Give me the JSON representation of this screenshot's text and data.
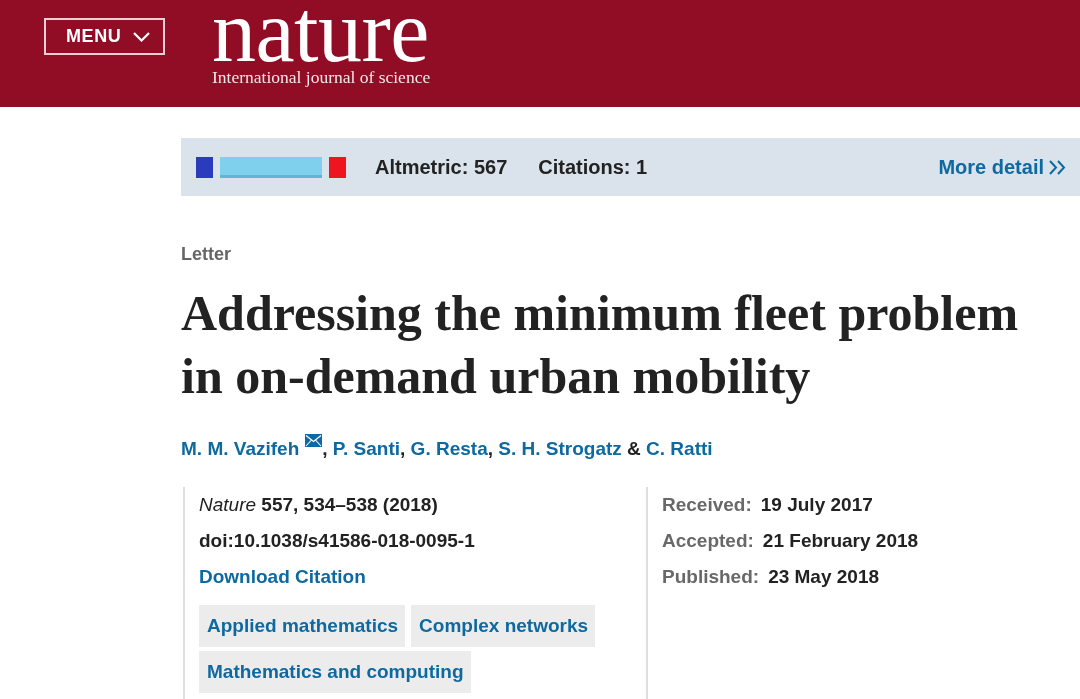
{
  "header": {
    "menu_button": "MENU",
    "logo": "nature",
    "tagline": "International journal of science"
  },
  "metrics_bar": {
    "altmetric": "Altmetric: 567",
    "citations": "Citations: 1",
    "more_link": "More detail"
  },
  "article": {
    "type": "Letter",
    "title": "Addressing the minimum fleet problem in on-demand urban mobility",
    "authors": [
      {
        "name": "M. M. Vazifeh",
        "corresponding": true,
        "separator": ", "
      },
      {
        "name": "P. Santi",
        "corresponding": false,
        "separator": ", "
      },
      {
        "name": "G. Resta",
        "corresponding": false,
        "separator": ", "
      },
      {
        "name": "S. H. Strogatz",
        "corresponding": false,
        "separator": " & "
      },
      {
        "name": "C. Ratti",
        "corresponding": false
      }
    ],
    "citation": "*Nature* **557, 534–538 (2018)**",
    "doi": "doi:10.1038/s41586-018-0095-1",
    "download_link": "Download Citation",
    "subjects": [
      "Applied mathematics",
      "Complex networks",
      "Mathematics and computing"
    ],
    "dates": [
      {
        "label": "Received:",
        "value": "19 July 2017"
      },
      {
        "label": "Accepted:",
        "value": "21 February 2018"
      },
      {
        "label": "Published:",
        "value": "23 May 2018"
      }
    ]
  }
}
